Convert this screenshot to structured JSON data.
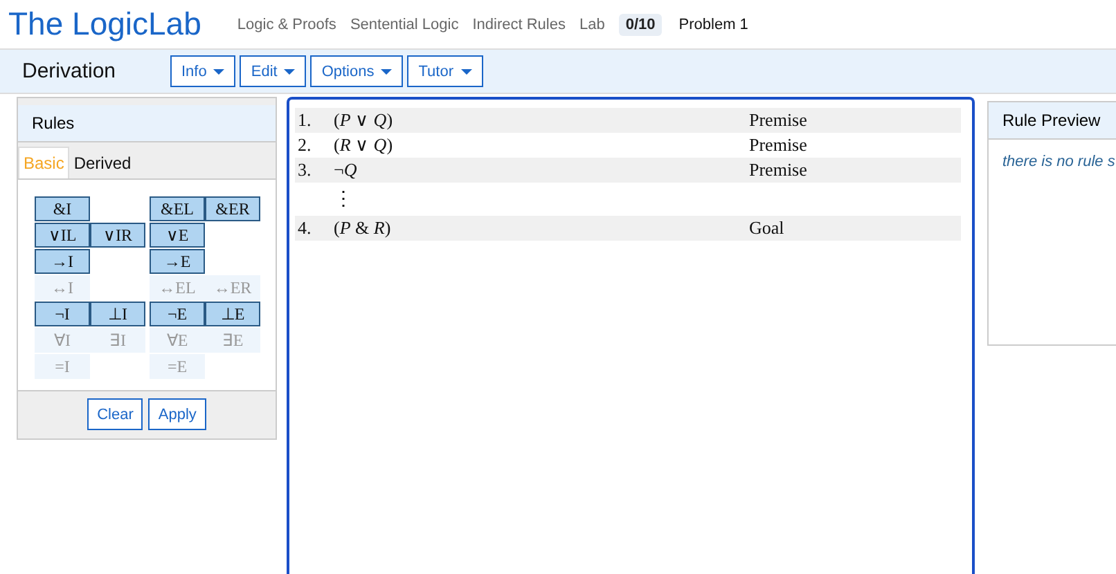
{
  "header": {
    "logo": "The LogicLab",
    "breadcrumbs": [
      "Logic & Proofs",
      "Sentential Logic",
      "Indirect Rules",
      "Lab"
    ],
    "score": "0/10",
    "problem": "Problem 1"
  },
  "toolbar": {
    "title": "Derivation",
    "menus": [
      "Info",
      "Edit",
      "Options",
      "Tutor"
    ]
  },
  "rules_panel": {
    "title": "Rules",
    "tabs": [
      {
        "label": "Basic",
        "selected": true
      },
      {
        "label": "Derived",
        "selected": false
      }
    ],
    "rows": [
      {
        "left": [
          {
            "label": "&I",
            "enabled": true
          }
        ],
        "right": [
          {
            "label": "&EL",
            "enabled": true
          },
          {
            "label": "&ER",
            "enabled": true
          }
        ]
      },
      {
        "left": [
          {
            "label": "∨IL",
            "enabled": true
          },
          {
            "label": "∨IR",
            "enabled": true
          }
        ],
        "right": [
          {
            "label": "∨E",
            "enabled": true
          }
        ]
      },
      {
        "left": [
          {
            "label": "→I",
            "enabled": true
          }
        ],
        "right": [
          {
            "label": "→E",
            "enabled": true
          }
        ]
      },
      {
        "left": [
          {
            "label": "↔I",
            "enabled": false
          }
        ],
        "right": [
          {
            "label": "↔EL",
            "enabled": false
          },
          {
            "label": "↔ER",
            "enabled": false
          }
        ]
      },
      {
        "left": [
          {
            "label": "¬I",
            "enabled": true
          },
          {
            "label": "⊥I",
            "enabled": true
          }
        ],
        "right": [
          {
            "label": "¬E",
            "enabled": true
          },
          {
            "label": "⊥E",
            "enabled": true
          }
        ]
      },
      {
        "left": [
          {
            "label": "∀I",
            "enabled": false
          },
          {
            "label": "∃I",
            "enabled": false
          }
        ],
        "right": [
          {
            "label": "∀E",
            "enabled": false
          },
          {
            "label": "∃E",
            "enabled": false
          }
        ]
      },
      {
        "left": [
          {
            "label": "=I",
            "enabled": false
          }
        ],
        "right": [
          {
            "label": "=E",
            "enabled": false
          }
        ]
      }
    ],
    "buttons": [
      "Clear",
      "Apply"
    ]
  },
  "derivation": {
    "lines": [
      {
        "kind": "line",
        "number": "1.",
        "formula": "(*P* ∨ *Q*)",
        "justification": "Premise"
      },
      {
        "kind": "line",
        "number": "2.",
        "formula": "(*R* ∨ *Q*)",
        "justification": "Premise"
      },
      {
        "kind": "line",
        "number": "3.",
        "formula": "¬*Q*",
        "justification": "Premise"
      },
      {
        "kind": "gap",
        "symbol": "⋮"
      },
      {
        "kind": "line",
        "number": "4.",
        "formula": "(*P* & *R*)",
        "justification": "Goal"
      }
    ]
  },
  "rule_preview": {
    "title": "Rule Preview",
    "message": "there is no rule s"
  }
}
